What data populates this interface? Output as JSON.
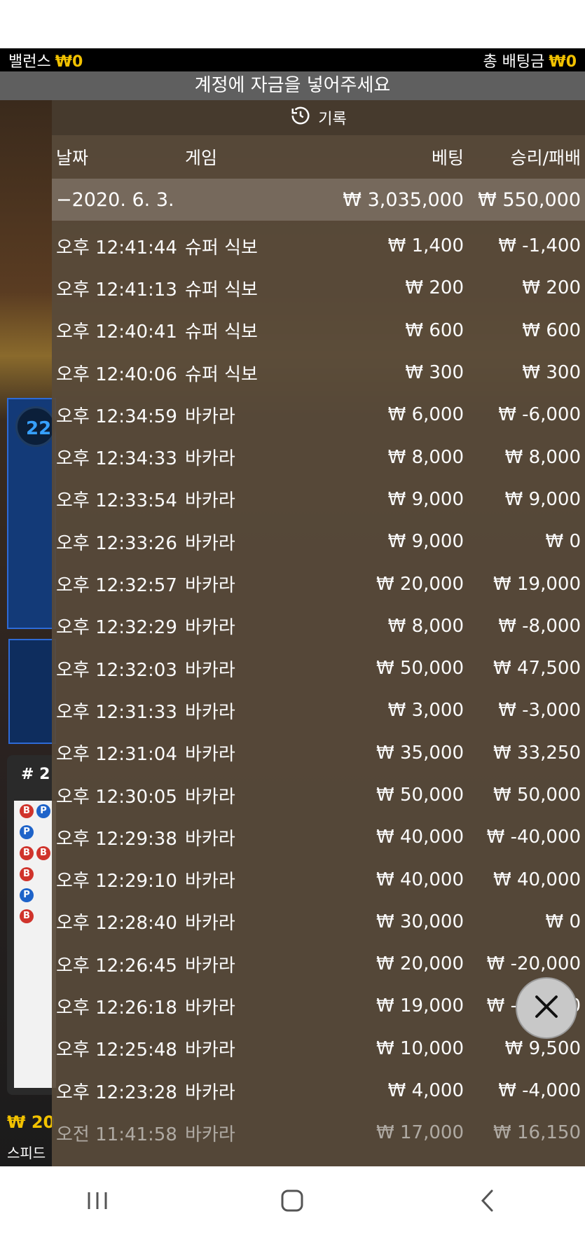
{
  "topbar": {
    "balance_label": "밸런스",
    "balance_amount": "₩0",
    "total_bet_label": "총 배팅금",
    "total_bet_amount": "₩0"
  },
  "notice": "계정에 자금을 넣어주세요",
  "background": {
    "round_number": "22",
    "hash": "# 2",
    "bottom_amount": "₩ 20",
    "bottom_text": "스피드"
  },
  "history": {
    "title": "기록",
    "columns": {
      "date": "날짜",
      "game": "게임",
      "bet": "베팅",
      "result": "승리/패배"
    },
    "date_group": {
      "date": "−2020. 6. 3.",
      "bet_total": "₩ 3,035,000",
      "result_total": "₩ 550,000"
    },
    "rows": [
      {
        "time": "오후 12:41:44",
        "game": "슈퍼 식보",
        "bet": "₩ 1,400",
        "result": "₩ -1,400"
      },
      {
        "time": "오후 12:41:13",
        "game": "슈퍼 식보",
        "bet": "₩ 200",
        "result": "₩ 200"
      },
      {
        "time": "오후 12:40:41",
        "game": "슈퍼 식보",
        "bet": "₩ 600",
        "result": "₩ 600"
      },
      {
        "time": "오후 12:40:06",
        "game": "슈퍼 식보",
        "bet": "₩ 300",
        "result": "₩ 300"
      },
      {
        "time": "오후 12:34:59",
        "game": "바카라",
        "bet": "₩ 6,000",
        "result": "₩ -6,000"
      },
      {
        "time": "오후 12:34:33",
        "game": "바카라",
        "bet": "₩ 8,000",
        "result": "₩ 8,000"
      },
      {
        "time": "오후 12:33:54",
        "game": "바카라",
        "bet": "₩ 9,000",
        "result": "₩ 9,000"
      },
      {
        "time": "오후 12:33:26",
        "game": "바카라",
        "bet": "₩ 9,000",
        "result": "₩ 0"
      },
      {
        "time": "오후 12:32:57",
        "game": "바카라",
        "bet": "₩ 20,000",
        "result": "₩ 19,000"
      },
      {
        "time": "오후 12:32:29",
        "game": "바카라",
        "bet": "₩ 8,000",
        "result": "₩ -8,000"
      },
      {
        "time": "오후 12:32:03",
        "game": "바카라",
        "bet": "₩ 50,000",
        "result": "₩ 47,500"
      },
      {
        "time": "오후 12:31:33",
        "game": "바카라",
        "bet": "₩ 3,000",
        "result": "₩ -3,000"
      },
      {
        "time": "오후 12:31:04",
        "game": "바카라",
        "bet": "₩ 35,000",
        "result": "₩ 33,250"
      },
      {
        "time": "오후 12:30:05",
        "game": "바카라",
        "bet": "₩ 50,000",
        "result": "₩ 50,000"
      },
      {
        "time": "오후 12:29:38",
        "game": "바카라",
        "bet": "₩ 40,000",
        "result": "₩ -40,000"
      },
      {
        "time": "오후 12:29:10",
        "game": "바카라",
        "bet": "₩ 40,000",
        "result": "₩ 40,000"
      },
      {
        "time": "오후 12:28:40",
        "game": "바카라",
        "bet": "₩ 30,000",
        "result": "₩ 0"
      },
      {
        "time": "오후 12:26:45",
        "game": "바카라",
        "bet": "₩ 20,000",
        "result": "₩ -20,000"
      },
      {
        "time": "오후 12:26:18",
        "game": "바카라",
        "bet": "₩ 19,000",
        "result": "₩ -19,000"
      },
      {
        "time": "오후 12:25:48",
        "game": "바카라",
        "bet": "₩ 10,000",
        "result": "₩ 9,500"
      },
      {
        "time": "오후 12:23:28",
        "game": "바카라",
        "bet": "₩ 4,000",
        "result": "₩ -4,000"
      },
      {
        "time": "오전 11:41:58",
        "game": "바카라",
        "bet": "₩ 17,000",
        "result": "₩ 16,150"
      }
    ]
  },
  "icons": {
    "history": "history-clock-icon",
    "close": "close-icon",
    "nav_recents": "recents-icon",
    "nav_home": "home-icon",
    "nav_back": "back-icon"
  }
}
